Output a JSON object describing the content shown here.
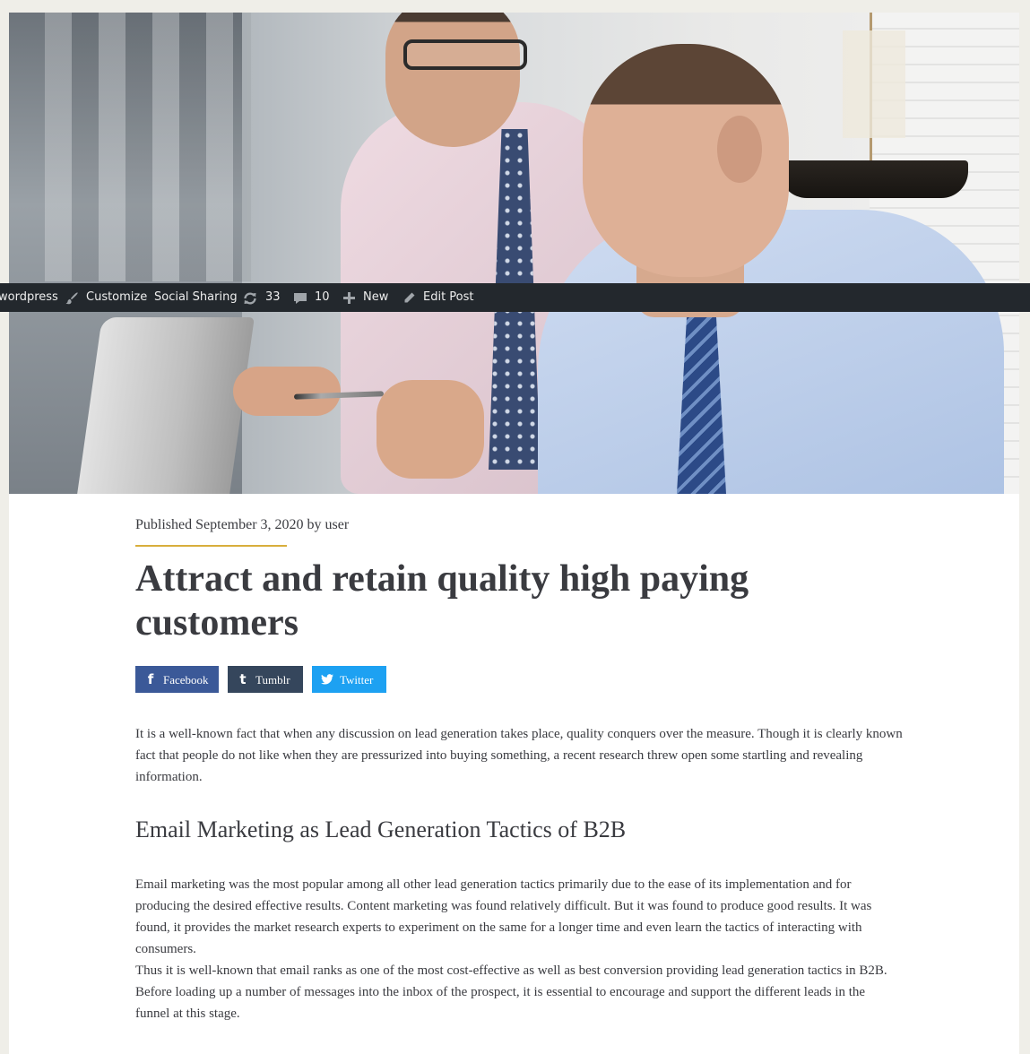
{
  "admin_bar": {
    "site_name": "wordpress",
    "customize": "Customize",
    "social_sharing": "Social Sharing",
    "updates_count": "33",
    "comments_count": "10",
    "new_label": "New",
    "edit_post": "Edit Post",
    "icons": [
      "customize-brush-icon",
      "updates-icon",
      "comments-icon",
      "plus-icon",
      "pencil-icon"
    ]
  },
  "hero": {
    "image_description": "two businessmen looking at a laptop"
  },
  "post": {
    "meta": "Published September 3, 2020 by user",
    "title": "Attract and retain quality high paying customers",
    "intro": "It is a well-known fact that when any discussion on lead generation takes place, quality conquers over the measure. Though it is clearly known fact that people do not like when they are pressurized into buying something, a recent research threw open some startling and revealing information.",
    "heading": "Email Marketing as Lead Generation Tactics of B2B",
    "para1": "Email marketing was the most popular among all other lead generation tactics primarily due to the ease of its implementation and for producing the desired effective results. Content marketing was found relatively difficult. But it was found to produce good results. It was found, it provides the market research experts to experiment on the same for a longer time and even learn the tactics of interacting with consumers.",
    "para2": "Thus it is well-known that email ranks as one of the most cost-effective as well as best conversion providing lead generation tactics in B2B. Before loading up a number of messages into the inbox of the prospect, it is essential to encourage and support the different leads in the funnel at this stage."
  },
  "share": {
    "facebook": "Facebook",
    "tumblr": "Tumblr",
    "twitter": "Twitter",
    "colors": {
      "facebook": "#3b5998",
      "tumblr": "#35465c",
      "twitter": "#1da1f2"
    }
  },
  "colors": {
    "accent_rule": "#d8ae3c",
    "admin_bar_bg": "#23282d",
    "text": "#3a3b40"
  }
}
